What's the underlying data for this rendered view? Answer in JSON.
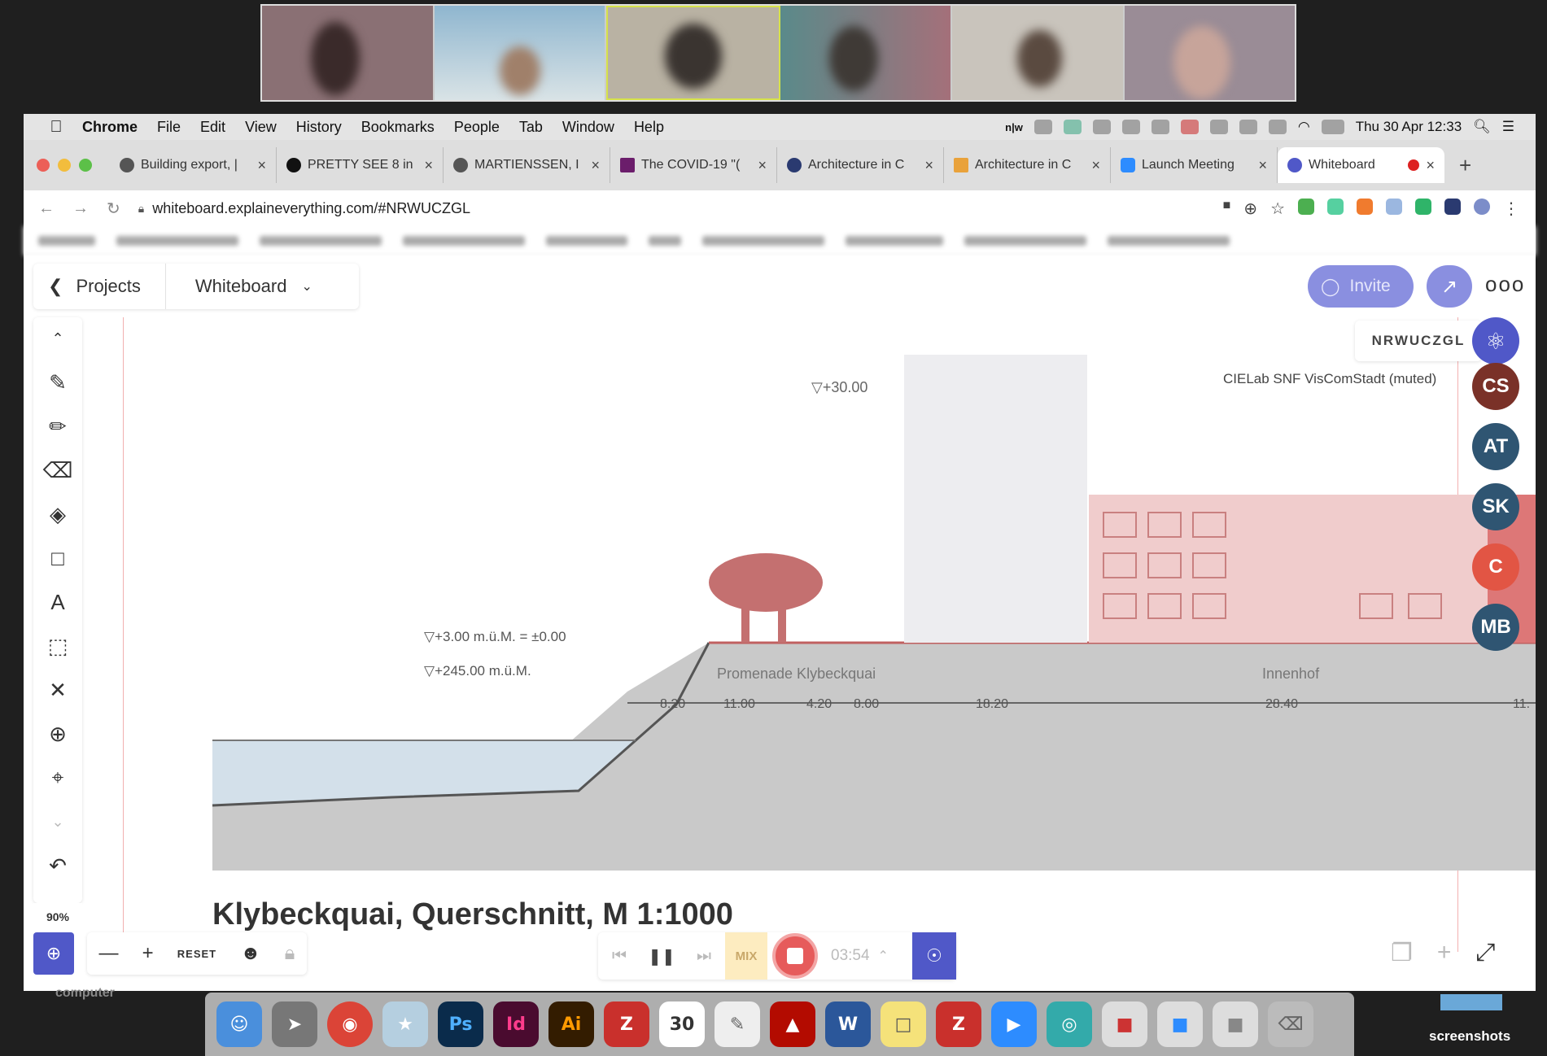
{
  "menubar": {
    "apple_icon": "apple-icon",
    "items": [
      "Chrome",
      "File",
      "Edit",
      "View",
      "History",
      "Bookmarks",
      "People",
      "Tab",
      "Window",
      "Help"
    ],
    "tray_label": "n|w",
    "clock": "Thu 30 Apr  12:33"
  },
  "browser": {
    "tabs": [
      {
        "title": "Building export, |",
        "active": false
      },
      {
        "title": "PRETTY SEE 8 in",
        "active": false
      },
      {
        "title": "MARTIENSSEN, I",
        "active": false
      },
      {
        "title": "The COVID-19 \"(",
        "active": false
      },
      {
        "title": "Architecture in C",
        "active": false
      },
      {
        "title": "Architecture in C",
        "active": false
      },
      {
        "title": "Launch Meeting",
        "active": false
      },
      {
        "title": "Whiteboard",
        "active": true
      }
    ],
    "new_tab": "+",
    "url": "whiteboard.explaineverything.com/#NRWUCZGL"
  },
  "whiteboard": {
    "back_label": "Projects",
    "board_name": "Whiteboard",
    "invite_label": "Invite",
    "more_label": "ooo",
    "session_code": "NRWUCZGL",
    "zoom_level": "90%",
    "reset_label": "RESET",
    "mix_label": "MIX",
    "timer": "03:54",
    "participant_status": "CIELab SNF VisComStadt (muted)",
    "participants": [
      {
        "initials": "CS",
        "color": "#7a3128"
      },
      {
        "initials": "AT",
        "color": "#2f5572"
      },
      {
        "initials": "SK",
        "color": "#2f5572"
      },
      {
        "initials": "C",
        "color": "#e25544"
      },
      {
        "initials": "MB",
        "color": "#2f5572"
      }
    ]
  },
  "drawing": {
    "caption": "Klybeckquai, Querschnitt, M 1:1000",
    "elevation_top": "▽+30.00",
    "elevation_mid": "▽+3.00 m.ü.M. = ±0.00",
    "elevation_low": "▽+245.00 m.ü.M.",
    "label_promenade": "Promenade  Klybeckquai",
    "label_innenhof": "Innenhof",
    "dimensions": [
      "8.20",
      "11.00",
      "4.20",
      "8.00",
      "18.20",
      "28.40",
      "11."
    ]
  },
  "desktop": {
    "left_label": "computer",
    "right_label": "screenshots"
  }
}
